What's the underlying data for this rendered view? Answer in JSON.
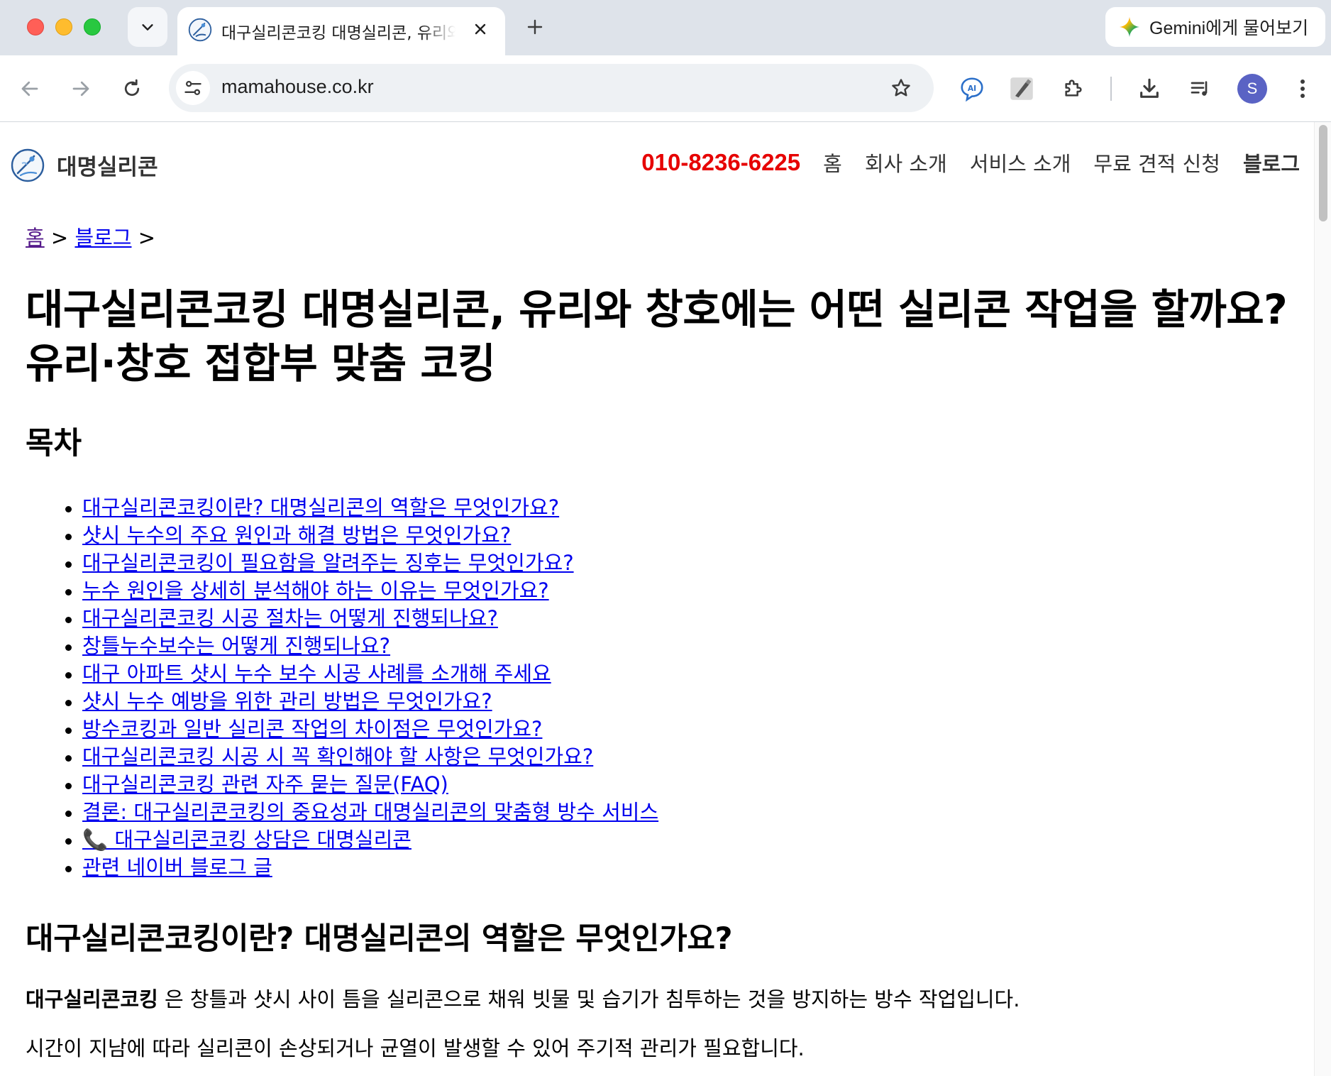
{
  "browser": {
    "active_tab": {
      "title": "대구실리콘코킹 대명실리콘, 유리와 창호에는 어떤 실리콘 작업을 할까요?"
    },
    "gemini_button": {
      "label": "Gemini에게 물어보기"
    },
    "address_bar": {
      "url": "mamahouse.co.kr"
    },
    "profile": {
      "initial": "S"
    },
    "icons": {
      "tab_search": "chevron-down-icon",
      "close": "close-icon",
      "new_tab": "plus-icon",
      "back": "arrow-left-icon",
      "forward": "arrow-right-icon",
      "reload": "reload-icon",
      "site_info": "tune-icon",
      "bookmark": "star-icon",
      "ai_extension": "ai-translate-icon",
      "tool_extension": "pen-tool-icon",
      "extensions": "puzzle-icon",
      "downloads": "download-icon",
      "media": "playlist-icon",
      "menu": "kebab-menu-icon"
    },
    "colors": {
      "frame": "#dee3ea",
      "omnibox": "#eef1f4",
      "avatar": "#5a63c4"
    }
  },
  "site": {
    "logo_text": "대명실리콘",
    "nav": {
      "phone": "010-8236-6225",
      "items": [
        "홈",
        "회사 소개",
        "서비스 소개",
        "무료 견적 신청",
        "블로그"
      ]
    },
    "colors": {
      "phone": "#e60000",
      "link": "#0000ee",
      "visited_link": "#551a8b"
    }
  },
  "page": {
    "breadcrumb": {
      "home": "홈",
      "sep1": " > ",
      "blog": "블로그",
      "sep2": " >"
    },
    "title": "대구실리콘코킹 대명실리콘, 유리와 창호에는 어떤 실리콘 작업을 할까요? 유리·창호 접합부 맞춤 코킹",
    "toc_title": "목차",
    "toc": [
      "대구실리콘코킹이란? 대명실리콘의 역할은 무엇인가요?",
      "샷시 누수의 주요 원인과 해결 방법은 무엇인가요?",
      "대구실리콘코킹이 필요함을 알려주는 징후는 무엇인가요?",
      "누수 원인을 상세히 분석해야 하는 이유는 무엇인가요?",
      "대구실리콘코킹 시공 절차는 어떻게 진행되나요?",
      "창틀누수보수는 어떻게 진행되나요?",
      "대구 아파트 샷시 누수 보수 시공 사례를 소개해 주세요",
      "샷시 누수 예방을 위한 관리 방법은 무엇인가요?",
      "방수코킹과 일반 실리콘 작업의 차이점은 무엇인가요?",
      "대구실리콘코킹 시공 시 꼭 확인해야 할 사항은 무엇인가요?",
      "대구실리콘코킹 관련 자주 묻는 질문(FAQ)",
      "결론: 대구실리콘코킹의 중요성과 대명실리콘의 맞춤형 방수 서비스",
      "📞 대구실리콘코킹 상담은 대명실리콘",
      "관련 네이버 블로그 글"
    ],
    "section1": {
      "heading": "대구실리콘코킹이란? 대명실리콘의 역할은 무엇인가요?",
      "para1_bold": "대구실리콘코킹",
      "para1_rest": " 은 창틀과 샷시 사이 틈을 실리콘으로 채워 빗물 및 습기가 침투하는 것을 방지하는 방수 작업입니다.",
      "para2": "시간이 지남에 따라 실리콘이 손상되거나 균열이 발생할 수 있어 주기적 관리가 필요합니다."
    }
  }
}
